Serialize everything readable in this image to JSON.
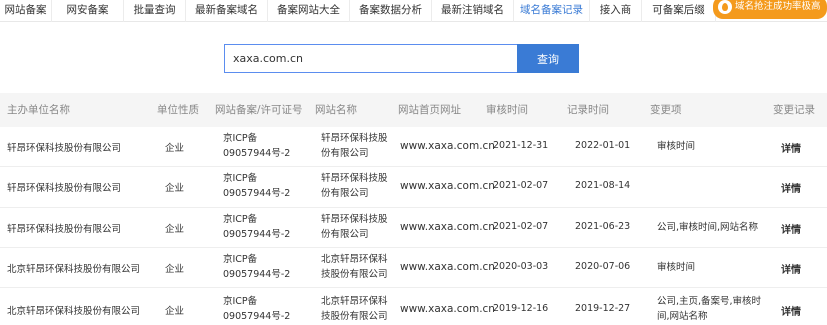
{
  "nav": {
    "tabs": [
      {
        "label": "网站备案",
        "active": false
      },
      {
        "label": "网安备案",
        "active": false
      },
      {
        "label": "批量查询",
        "active": false
      },
      {
        "label": "最新备案域名",
        "active": false
      },
      {
        "label": "备案网站大全",
        "active": false
      },
      {
        "label": "备案数据分析",
        "active": false
      },
      {
        "label": "最新注销域名",
        "active": false
      },
      {
        "label": "域名备案记录",
        "active": true
      },
      {
        "label": "接入商",
        "active": false
      },
      {
        "label": "可备案后缀",
        "active": false
      }
    ],
    "badge": "域名抢注成功率极高"
  },
  "search": {
    "value": "xaxa.com.cn",
    "button_label": "查询"
  },
  "table": {
    "headers": [
      "主办单位名称",
      "单位性质",
      "网站备案/许可证号",
      "网站名称",
      "网站首页网址",
      "审核时间",
      "记录时间",
      "变更项",
      "变更记录"
    ],
    "rows": [
      {
        "org": "轩昂环保科技股份有限公司",
        "type": "企业",
        "license": "京ICP备09057944号-2",
        "site_name": "轩昂环保科技股份有限公司",
        "url": "www.xaxa.com.cn",
        "audit_date": "2021-12-31",
        "record_date": "2022-01-01",
        "change": "审核时间",
        "detail": "详情"
      },
      {
        "org": "轩昂环保科技股份有限公司",
        "type": "企业",
        "license": "京ICP备09057944号-2",
        "site_name": "轩昂环保科技股份有限公司",
        "url": "www.xaxa.com.cn",
        "audit_date": "2021-02-07",
        "record_date": "2021-08-14",
        "change": "",
        "detail": "详情"
      },
      {
        "org": "轩昂环保科技股份有限公司",
        "type": "企业",
        "license": "京ICP备09057944号-2",
        "site_name": "轩昂环保科技股份有限公司",
        "url": "www.xaxa.com.cn",
        "audit_date": "2021-02-07",
        "record_date": "2021-06-23",
        "change": "公司,审核时间,网站名称",
        "detail": "详情"
      },
      {
        "org": "北京轩昂环保科技股份有限公司",
        "type": "企业",
        "license": "京ICP备09057944号-2",
        "site_name": "北京轩昂环保科技股份有限公司",
        "url": "www.xaxa.com.cn",
        "audit_date": "2020-03-03",
        "record_date": "2020-07-06",
        "change": "审核时间",
        "detail": "详情"
      },
      {
        "org": "北京轩昂环保科技股份有限公司",
        "type": "企业",
        "license": "京ICP备09057944号-2",
        "site_name": "北京轩昂环保科技股份有限公司",
        "url": "www.xaxa.com.cn",
        "audit_date": "2019-12-16",
        "record_date": "2019-12-27",
        "change": "公司,主页,备案号,审核时间,网站名称",
        "detail": "详情"
      }
    ]
  },
  "colors": {
    "accent": "#3a7bd5",
    "badge": "#f49a1c",
    "header_bg": "#f5f5f5"
  }
}
